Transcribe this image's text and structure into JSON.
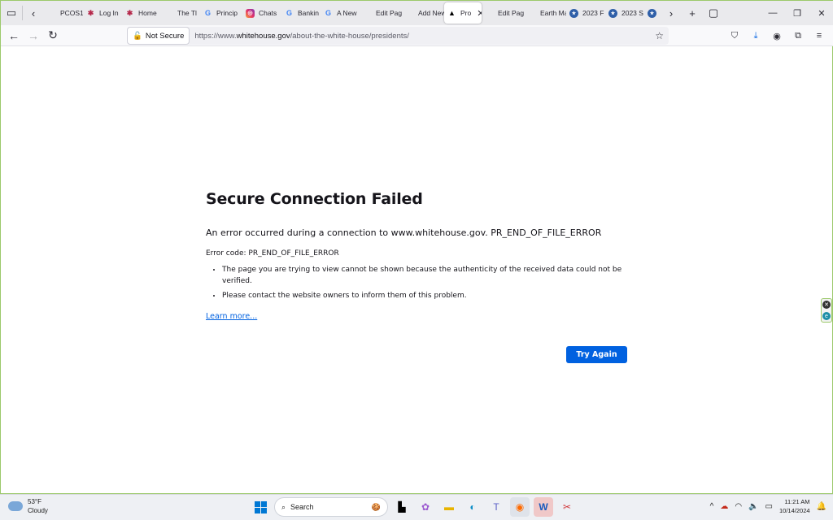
{
  "browser": {
    "tabs": [
      {
        "label": "PCOS1",
        "favicon": "blank-icon"
      },
      {
        "label": "Log In",
        "favicon": "star-logo-icon"
      },
      {
        "label": "Home",
        "favicon": "star-logo-icon"
      },
      {
        "label": "The Tl",
        "favicon": "blank-icon"
      },
      {
        "label": "Princip",
        "favicon": "google-icon"
      },
      {
        "label": "Chats",
        "favicon": "instagram-icon"
      },
      {
        "label": "Bankin",
        "favicon": "google-icon"
      },
      {
        "label": "A New",
        "favicon": "google-icon"
      },
      {
        "label": "Edit Page",
        "favicon": "blank-icon"
      },
      {
        "label": "Add New",
        "favicon": "blank-icon"
      },
      {
        "label": "Pro",
        "favicon": "warning-icon",
        "active": true
      },
      {
        "label": "Edit Page",
        "favicon": "blank-icon"
      },
      {
        "label": "Earth Mar",
        "favicon": "blank-icon"
      },
      {
        "label": "2023 F",
        "favicon": "seal-icon"
      },
      {
        "label": "2023 S",
        "favicon": "seal-icon"
      },
      {
        "label": "",
        "favicon": "seal-icon"
      }
    ],
    "security_label": "Not Secure",
    "url_prefix": "https://www.",
    "url_host": "whitehouse.gov",
    "url_path": "/about-the-white-house/presidents/"
  },
  "error_page": {
    "title": "Secure Connection Failed",
    "lead": "An error occurred during a connection to www.whitehouse.gov. PR_END_OF_FILE_ERROR",
    "code": "Error code: PR_END_OF_FILE_ERROR",
    "bullets": [
      "The page you are trying to view cannot be shown because the authenticity of the received data could not be verified.",
      "Please contact the website owners to inform them of this problem."
    ],
    "learn_more": "Learn more...",
    "try_again": "Try Again"
  },
  "taskbar": {
    "weather_temp": "53°F",
    "weather_desc": "Cloudy",
    "search_label": "Search",
    "time": "11:21 AM",
    "date": "10/14/2024"
  },
  "colors": {
    "accent": "#0061e0",
    "frame_border": "#9cc96b"
  }
}
